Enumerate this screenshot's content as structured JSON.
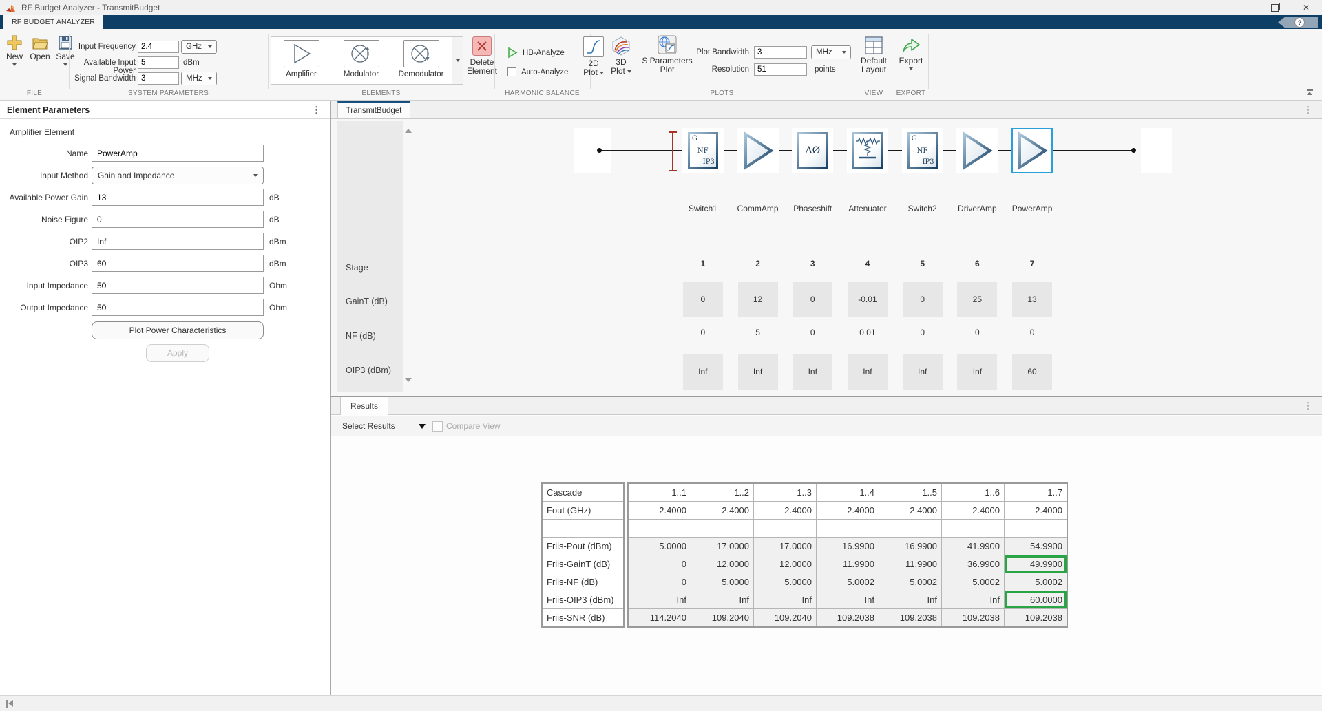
{
  "titlebar": {
    "title": "RF Budget Analyzer - TransmitBudget"
  },
  "ribbon": {
    "tab_label": "RF BUDGET ANALYZER",
    "file": {
      "section": "FILE",
      "new_label": "New",
      "open_label": "Open",
      "save_label": "Save"
    },
    "system_parameters": {
      "section": "SYSTEM PARAMETERS",
      "input_frequency_label": "Input Frequency",
      "input_frequency_value": "2.4",
      "input_frequency_unit": "GHz",
      "available_input_power_label": "Available Input Power",
      "available_input_power_value": "5",
      "available_input_power_unit": "dBm",
      "signal_bandwidth_label": "Signal Bandwidth",
      "signal_bandwidth_value": "3",
      "signal_bandwidth_unit": "MHz"
    },
    "elements": {
      "section": "ELEMENTS",
      "amplifier_label": "Amplifier",
      "modulator_label": "Modulator",
      "demodulator_label": "Demodulator",
      "delete_line1": "Delete",
      "delete_line2": "Element"
    },
    "harmonic_balance": {
      "section": "HARMONIC BALANCE",
      "hb_analyze_label": "HB-Analyze",
      "auto_analyze_label": "Auto-Analyze"
    },
    "plots": {
      "section": "PLOTS",
      "plot2d_line1": "2D",
      "plot2d_line2": "Plot",
      "plot3d_line1": "3D",
      "plot3d_line2": "Plot",
      "sparams_line1": "S Parameters",
      "sparams_line2": "Plot",
      "plot_bandwidth_label": "Plot Bandwidth",
      "plot_bandwidth_value": "3",
      "plot_bandwidth_unit": "MHz",
      "resolution_label": "Resolution",
      "resolution_value": "51",
      "resolution_unit": "points"
    },
    "view": {
      "section": "VIEW",
      "default_layout_line1": "Default",
      "default_layout_line2": "Layout"
    },
    "export": {
      "section": "EXPORT",
      "export_label": "Export"
    }
  },
  "element_parameters": {
    "title": "Element Parameters",
    "subtitle": "Amplifier Element",
    "name_label": "Name",
    "name_value": "PowerAmp",
    "input_method_label": "Input Method",
    "input_method_value": "Gain and Impedance",
    "gain_label": "Available Power Gain",
    "gain_value": "13",
    "gain_unit": "dB",
    "nf_label": "Noise Figure",
    "nf_value": "0",
    "nf_unit": "dB",
    "oip2_label": "OIP2",
    "oip2_value": "Inf",
    "oip2_unit": "dBm",
    "oip3_label": "OIP3",
    "oip3_value": "60",
    "oip3_unit": "dBm",
    "zin_label": "Input Impedance",
    "zin_value": "50",
    "zin_unit": "Ohm",
    "zout_label": "Output Impedance",
    "zout_value": "50",
    "zout_unit": "Ohm",
    "plot_button": "Plot Power Characteristics",
    "apply_button": "Apply"
  },
  "figure": {
    "tab_label": "TransmitBudget",
    "box_glyph": {
      "g": "G",
      "nf": "NF",
      "ip3": "IP3"
    },
    "phase_glyph": "ΔØ",
    "chain": {
      "names": [
        "Switch1",
        "CommAmp",
        "Phaseshift",
        "Attenuator",
        "Switch2",
        "DriverAmp",
        "PowerAmp"
      ]
    },
    "stage_table": {
      "row_labels": [
        "Stage",
        "GainT (dB)",
        "NF (dB)",
        "OIP3 (dBm)"
      ],
      "stage": [
        "1",
        "2",
        "3",
        "4",
        "5",
        "6",
        "7"
      ],
      "gain": [
        "0",
        "12",
        "0",
        "-0.01",
        "0",
        "25",
        "13"
      ],
      "nf": [
        "0",
        "5",
        "0",
        "0.01",
        "0",
        "0",
        "0"
      ],
      "oip3": [
        "Inf",
        "Inf",
        "Inf",
        "Inf",
        "Inf",
        "Inf",
        "60"
      ]
    }
  },
  "results": {
    "tab_label": "Results",
    "select_results_label": "Select Results",
    "compare_view_label": "Compare View",
    "table": {
      "header_label": "Cascade",
      "columns": [
        "1..1",
        "1..2",
        "1..3",
        "1..4",
        "1..5",
        "1..6",
        "1..7"
      ],
      "rows": [
        {
          "label": "Fout (GHz)",
          "values": [
            "2.4000",
            "2.4000",
            "2.4000",
            "2.4000",
            "2.4000",
            "2.4000",
            "2.4000"
          ]
        },
        {
          "label": "",
          "values": [
            "",
            "",
            "",
            "",
            "",
            "",
            ""
          ]
        },
        {
          "label": "Friis-Pout (dBm)",
          "values": [
            "5.0000",
            "17.0000",
            "17.0000",
            "16.9900",
            "16.9900",
            "41.9900",
            "54.9900"
          ]
        },
        {
          "label": "Friis-GainT (dB)",
          "values": [
            "0",
            "12.0000",
            "12.0000",
            "11.9900",
            "11.9900",
            "36.9900",
            "49.9900"
          ]
        },
        {
          "label": "Friis-NF (dB)",
          "values": [
            "0",
            "5.0000",
            "5.0000",
            "5.0002",
            "5.0002",
            "5.0002",
            "5.0002"
          ]
        },
        {
          "label": "Friis-OIP3 (dBm)",
          "values": [
            "Inf",
            "Inf",
            "Inf",
            "Inf",
            "Inf",
            "Inf",
            "60.0000"
          ]
        },
        {
          "label": "Friis-SNR (dB)",
          "values": [
            "114.2040",
            "109.2040",
            "109.2040",
            "109.2038",
            "109.2038",
            "109.2038",
            "109.2038"
          ]
        }
      ]
    }
  }
}
